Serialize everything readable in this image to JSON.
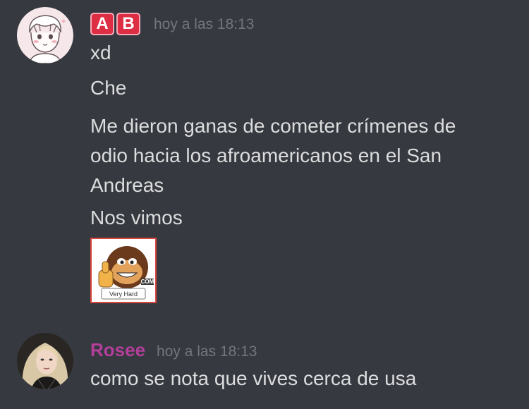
{
  "messages": [
    {
      "author": {
        "badges": [
          "A",
          "B"
        ],
        "name": ""
      },
      "timestamp": "hoy a las 18:13",
      "lines": [
        "xd",
        "Che",
        "Me dieron ganas de cometer crímenes de odio hacia los afroamericanos en el San Andreas",
        "Nos vimos"
      ],
      "sticker": {
        "label": "Very Hard",
        "badge_text": "COM",
        "icon": "thumbs-up-ape-sticker"
      }
    },
    {
      "author": {
        "name": "Rosee",
        "name_color": "#b33f9b"
      },
      "timestamp": "hoy a las 18:13",
      "lines": [
        "como se nota que vives cerca de usa"
      ]
    }
  ],
  "colors": {
    "background": "#36393f",
    "text": "#dcddde",
    "timestamp": "#72767d",
    "badge": "#dd2e44"
  }
}
